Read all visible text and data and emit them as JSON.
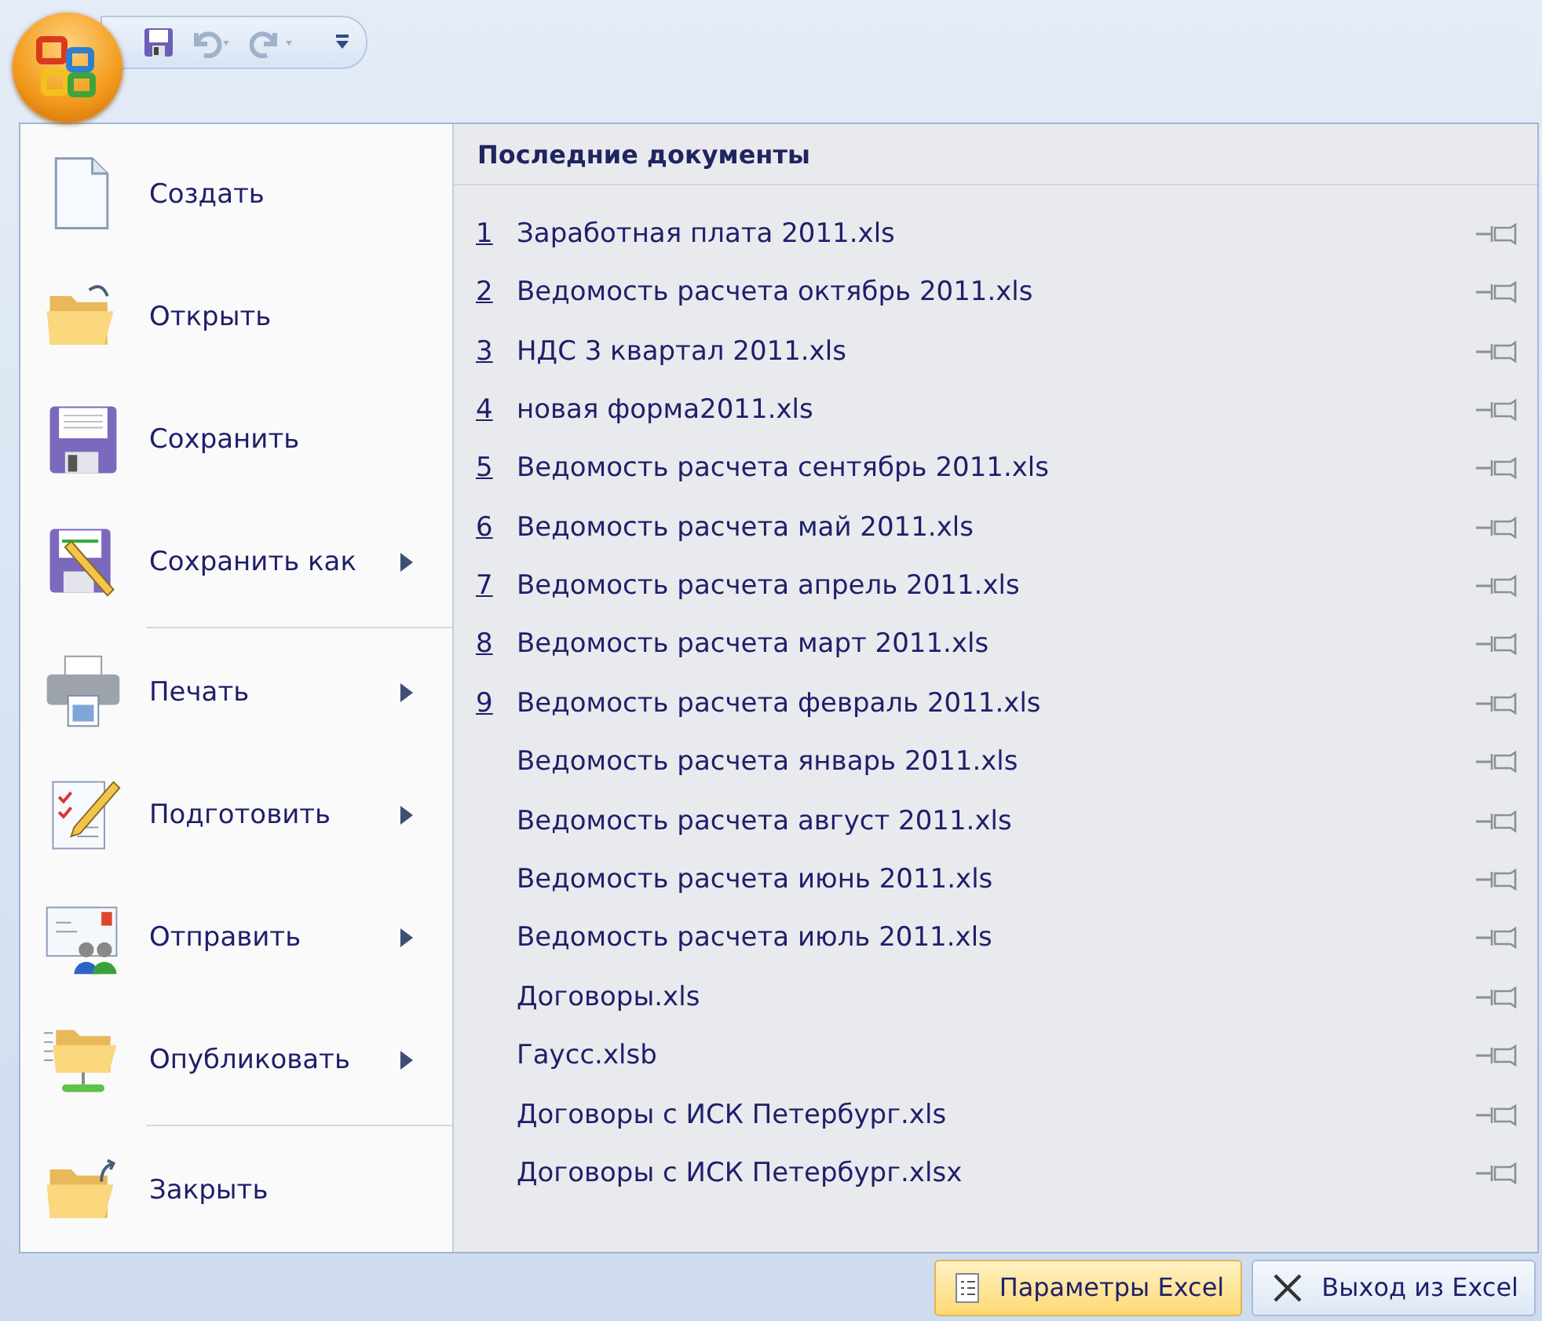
{
  "quick_access": {
    "buttons": [
      {
        "kind": "save",
        "disabled": false
      },
      {
        "kind": "undo",
        "disabled": true
      },
      {
        "kind": "redo",
        "disabled": true
      }
    ]
  },
  "menu": {
    "items": [
      {
        "kind": "new",
        "text": "Создать",
        "submenu": false
      },
      {
        "kind": "open",
        "text": "Открыть",
        "submenu": false
      },
      {
        "kind": "save",
        "text": "Сохранить",
        "submenu": false
      },
      {
        "kind": "saveas",
        "text": "Сохранить как",
        "submenu": true
      },
      {
        "kind": "separator"
      },
      {
        "kind": "print",
        "text": "Печать",
        "submenu": true
      },
      {
        "kind": "prepare",
        "text": "Подготовить",
        "submenu": true
      },
      {
        "kind": "send",
        "text": "Отправить",
        "submenu": true
      },
      {
        "kind": "publish",
        "text": "Опубликовать",
        "submenu": true
      },
      {
        "kind": "separator"
      },
      {
        "kind": "close",
        "text": "Закрыть",
        "submenu": false
      }
    ]
  },
  "recent": {
    "title": "Последние документы",
    "documents": [
      {
        "number": "1",
        "name": "Заработная плата 2011.xls"
      },
      {
        "number": "2",
        "name": "Ведомость расчета октябрь 2011.xls"
      },
      {
        "number": "3",
        "name": "НДС 3 квартал 2011.xls"
      },
      {
        "number": "4",
        "name": "новая форма2011.xls"
      },
      {
        "number": "5",
        "name": "Ведомость расчета сентябрь 2011.xls"
      },
      {
        "number": "6",
        "name": "Ведомость расчета май 2011.xls"
      },
      {
        "number": "7",
        "name": "Ведомость расчета апрель 2011.xls"
      },
      {
        "number": "8",
        "name": "Ведомость расчета март 2011.xls"
      },
      {
        "number": "9",
        "name": "Ведомость расчета февраль 2011.xls"
      },
      {
        "name": "Ведомость расчета январь 2011.xls"
      },
      {
        "name": "Ведомость расчета август 2011.xls"
      },
      {
        "name": "Ведомость расчета июнь 2011.xls"
      },
      {
        "name": "Ведомость расчета июль 2011.xls"
      },
      {
        "name": "Договоры.xls"
      },
      {
        "name": "Гаусс.xlsb"
      },
      {
        "name": "Договоры с ИСК Петербург.xls"
      },
      {
        "name": "Договоры с ИСК Петербург.xlsx"
      }
    ]
  },
  "footer": {
    "buttons": [
      {
        "kind": "options",
        "text": "Параметры Excel",
        "highlighted": true
      },
      {
        "kind": "exit",
        "text": "Выход из Excel",
        "highlighted": false
      }
    ]
  }
}
